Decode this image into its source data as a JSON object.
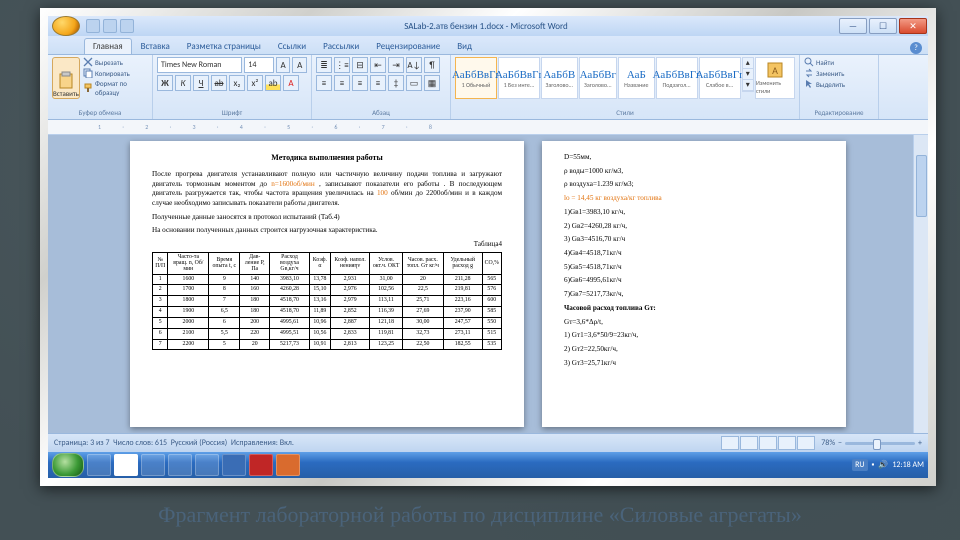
{
  "window": {
    "title": "SALab-2.атв бензин 1.docx - Microsoft Word"
  },
  "tabs": [
    "Главная",
    "Вставка",
    "Разметка страницы",
    "Ссылки",
    "Рассылки",
    "Рецензирование",
    "Вид"
  ],
  "activeTab": 0,
  "groups": {
    "clipboard": "Буфер обмена",
    "font": "Шрифт",
    "para": "Абзац",
    "styles": "Стили",
    "edit": "Редактирование"
  },
  "clipboard": {
    "paste": "Вставить",
    "cut": "Вырезать",
    "copy": "Копировать",
    "fmt": "Формат по образцу"
  },
  "font": {
    "name": "Times New Roman",
    "size": "14"
  },
  "styleGallery": [
    {
      "prev": "АаБбВвГг",
      "label": "1 Обычный"
    },
    {
      "prev": "АаБбВвГг",
      "label": "1 Без инте..."
    },
    {
      "prev": "АаБбВ",
      "label": "Заголово..."
    },
    {
      "prev": "АаБбВг",
      "label": "Заголово..."
    },
    {
      "prev": "АаБ",
      "label": "Название"
    },
    {
      "prev": "АаБбВвГг",
      "label": "Подзагол..."
    },
    {
      "prev": "АаБбВвГг",
      "label": "Слабое в..."
    }
  ],
  "stylesChange": "Изменить стили",
  "editing": {
    "find": "Найти",
    "replace": "Заменить",
    "select": "Выделить"
  },
  "ruler5": "1 · 2 · 3 · 4 · 5 · 6 · 7 · 8",
  "doc": {
    "title": "Методика выполнения работы",
    "p1a": "После прогрева двигателя устанавливают полную или частичную величину подачи топлива и загружают двигатель тормозным моментом до ",
    "p1b": "n=1600об/мин",
    "p1c": " , записывают показатели его работы . В последующем двигатель разгружается так, чтобы частота вращения увеличилась на ",
    "p1d": "100",
    "p1e": " об/мин до 2200об/мин и в каждом случае необходимо записывать показатели работы двигателя.",
    "p2": "Полученные данные заносятся в протокол испытаний (Таб.4)",
    "p3": "На основании полученных данных строится нагрузочная характеристика.",
    "tblLabel": "Таблица4",
    "headers": [
      "№ П/П",
      "Часто-та вращ. n, Об/мин",
      "Время опыта t, с",
      "Дав-ление Р, Па",
      "Расход воздуха Gв,кг/ч",
      "Коэф. α",
      "Коэф. напол. ненияηv",
      "Услов. окт.ч. ОКТ",
      "Часов. расх. топл. Gт кг/ч",
      "Удельный расход g",
      "СО,%"
    ],
    "rows": [
      [
        "1",
        "1600",
        "9",
        "140",
        "3983,10",
        "13,78",
        "2,931",
        "31,00",
        "20",
        "211,28",
        "565"
      ],
      [
        "2",
        "1700",
        "8",
        "160",
        "4260,28",
        "15,10",
        "2,976",
        "102,56",
        "22,5",
        "219,81",
        "576"
      ],
      [
        "3",
        "1800",
        "7",
        "180",
        "4518,70",
        "13,16",
        "2,979",
        "113,11",
        "25,71",
        "223,16",
        "600"
      ],
      [
        "4",
        "1900",
        "6,5",
        "180",
        "4518,70",
        "11,89",
        "2,852",
        "116,39",
        "27,69",
        "237,90",
        "585"
      ],
      [
        "5",
        "2000",
        "6",
        "200",
        "4995,61",
        "10,96",
        "2,887",
        "121,18",
        "30,00",
        "247,57",
        "550"
      ],
      [
        "6",
        "2100",
        "5,5",
        "220",
        "4995,51",
        "10,56",
        "2,833",
        "119,81",
        "32,73",
        "273,11",
        "515"
      ],
      [
        "7",
        "2200",
        "5",
        "20",
        "5217,73",
        "10,91",
        "2,813",
        "123,25",
        "22,50",
        "182,55",
        "535"
      ]
    ]
  },
  "rightCol": {
    "D": "D=55мм,",
    "rho_w": "ρ воды=1000 кг/м3,",
    "rho_a": "ρ воздуха=1.239 кг/м3;",
    "lo": "lo = 14,45 кг воздуха/кг топлива",
    "Gv": [
      "1)Gв1=3983,10 кг/ч,",
      "2) Gв2=4260,28 кг/ч,",
      "3) Gв3=4516,70 кг/ч",
      "4)Gв4=4518,71кг/ч",
      "5)Gв5=4518,71кг/ч",
      "6)Gв6=4995,61кг/ч",
      "7)Gв7=5217,73кг/ч,"
    ],
    "Gth": "Часовой расход топлива Gт:",
    "Gtf": "Gт=3,6*Δρ/t,",
    "Gt": [
      "1) Gт1=3,6*50/9=23кг/ч,",
      "2) Gт2=22,50кг/ч,",
      "3) Gт3=25,71кг/ч"
    ]
  },
  "status": {
    "page": "Страница: 3 из 7",
    "words": "Число слов: 615",
    "lang": "Русский (Россия)",
    "extra": "Исправления: Вкл.",
    "zoom": "78%"
  },
  "tray": {
    "lang": "RU",
    "time": "12:18 AM"
  },
  "caption": "Фрагмент лабораторной работы по дисциплине «Силовые агрегаты»"
}
